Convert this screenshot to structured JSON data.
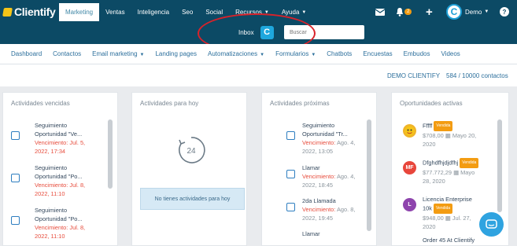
{
  "header": {
    "logo_text": "Clientify",
    "menu": [
      {
        "label": "Marketing",
        "active": true,
        "dropdown": false
      },
      {
        "label": "Ventas",
        "active": false,
        "dropdown": false
      },
      {
        "label": "Inteligencia",
        "active": false,
        "dropdown": false
      },
      {
        "label": "Seo",
        "active": false,
        "dropdown": false
      },
      {
        "label": "Social",
        "active": false,
        "dropdown": false
      },
      {
        "label": "Recursos",
        "active": false,
        "dropdown": true
      },
      {
        "label": "Ayuda",
        "active": false,
        "dropdown": true
      }
    ],
    "notifications_count": "2",
    "user_name": "Demo",
    "help_glyph": "?",
    "inbox_label": "Inbox",
    "search_placeholder": "Buscar"
  },
  "subnav": [
    {
      "label": "Dashboard",
      "dropdown": false
    },
    {
      "label": "Contactos",
      "dropdown": false
    },
    {
      "label": "Email marketing",
      "dropdown": true
    },
    {
      "label": "Landing pages",
      "dropdown": false
    },
    {
      "label": "Automatizaciones",
      "dropdown": true
    },
    {
      "label": "Formularios",
      "dropdown": true
    },
    {
      "label": "Chatbots",
      "dropdown": false
    },
    {
      "label": "Encuestas",
      "dropdown": false
    },
    {
      "label": "Embudos",
      "dropdown": false
    },
    {
      "label": "Videos",
      "dropdown": false
    }
  ],
  "info": {
    "company": "DEMO CLIENTIFY",
    "contacts": "584 / 10000 contactos"
  },
  "columns": {
    "vencidas": {
      "title": "Actividades vencidas",
      "items": [
        {
          "l1": "Seguimiento",
          "l2": "Oportunidad \"Ve...",
          "due_label": "Vencimiento:",
          "due": "Jul. 5,",
          "l4": "2022, 17:34"
        },
        {
          "l1": "Seguimiento",
          "l2": "Oportunidad \"Po...",
          "due_label": "Vencimiento:",
          "due": "Jul. 8,",
          "l4": "2022, 11:10"
        },
        {
          "l1": "Seguimiento",
          "l2": "Oportunidad \"Po...",
          "due_label": "Vencimiento:",
          "due": "Jul. 8,",
          "l4": "2022, 11:10"
        }
      ]
    },
    "hoy": {
      "title": "Actividades para hoy",
      "clock_number": "24",
      "empty_text": "No tienes actividades para hoy"
    },
    "proximas": {
      "title": "Actividades próximas",
      "items": [
        {
          "l1": "Seguimiento",
          "l2": "Oportunidad \"Tr...",
          "due_label": "Vencimiento:",
          "due": "Ago. 4,",
          "l4": "2022, 13:05"
        },
        {
          "l1": "Llamar",
          "l2": "",
          "due_label": "Vencimiento:",
          "due": "Ago. 4,",
          "l4": "2022, 18:45"
        },
        {
          "l1": "2da Llamada",
          "l2": "",
          "due_label": "Vencimiento:",
          "due": "Ago. 8,",
          "l4": "2022, 19:45"
        },
        {
          "l1": "Llamar",
          "l2": "",
          "due_label": "",
          "due": "",
          "l4": ""
        }
      ]
    },
    "oportunidades": {
      "title": "Oportunidades activas",
      "items": [
        {
          "name": "Fffff",
          "badge": "Vendida",
          "amount": "$708,00",
          "date_a": "Mayo 20,",
          "date_b": "2020",
          "avatar": "",
          "avatar_color": "#e67e22"
        },
        {
          "name": "Dfghdfhjdjdfhj",
          "badge": "Vendida",
          "amount": "$77.772,29",
          "date_a": "Mayo",
          "date_b": "28, 2020",
          "avatar": "MF",
          "avatar_color": "#e8463b"
        },
        {
          "name": "Licencia Enterprise",
          "name2": "10k",
          "badge": "Vendida",
          "amount": "$948,00",
          "date_a": "Jul. 27,",
          "date_b": "2020",
          "avatar": "L",
          "avatar_color": "#8e44ad"
        },
        {
          "name": "Order 45 At Clientify",
          "badge": "",
          "amount": "",
          "date_a": "",
          "date_b": "",
          "avatar": "",
          "avatar_color": ""
        }
      ]
    }
  }
}
